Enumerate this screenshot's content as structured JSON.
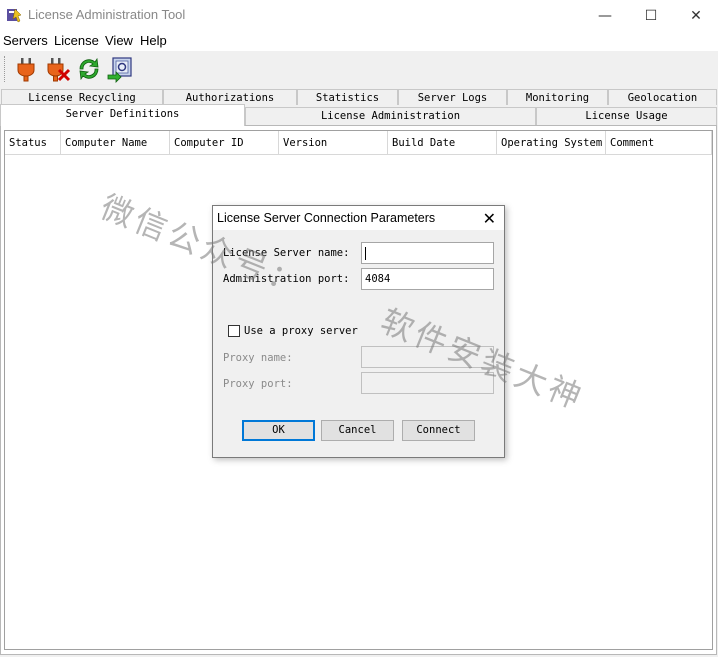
{
  "window": {
    "title": "License Administration Tool",
    "minimize": "—",
    "maximize": "☐",
    "close": "✕"
  },
  "menu": [
    "Servers",
    "License",
    "View",
    "Help"
  ],
  "toolbar": {
    "icons": [
      "connect-plug-icon",
      "disconnect-plug-icon",
      "refresh-icon",
      "server-settings-icon"
    ]
  },
  "tabs": {
    "row1": [
      "License Recycling",
      "Authorizations",
      "Statistics",
      "Server Logs",
      "Monitoring",
      "Geolocation"
    ],
    "row2": [
      "Server Definitions",
      "License Administration",
      "License Usage"
    ],
    "selected": "Server Definitions"
  },
  "table": {
    "columns": [
      "Status",
      "Computer Name",
      "Computer ID",
      "Version",
      "Build Date",
      "Operating System",
      "Comment"
    ]
  },
  "watermark": {
    "line1": "微信公众号：",
    "line2": "软件安装大神"
  },
  "dialog": {
    "title": "License Server Connection Parameters",
    "server_name_label": "License Server name:",
    "server_name_value": "",
    "admin_port_label": "Administration port:",
    "admin_port_value": "4084",
    "proxy_checkbox_label": "Use a proxy server",
    "proxy_checked": false,
    "proxy_name_label": "Proxy name:",
    "proxy_port_label": "Proxy port:",
    "ok": "OK",
    "cancel": "Cancel",
    "connect": "Connect"
  }
}
